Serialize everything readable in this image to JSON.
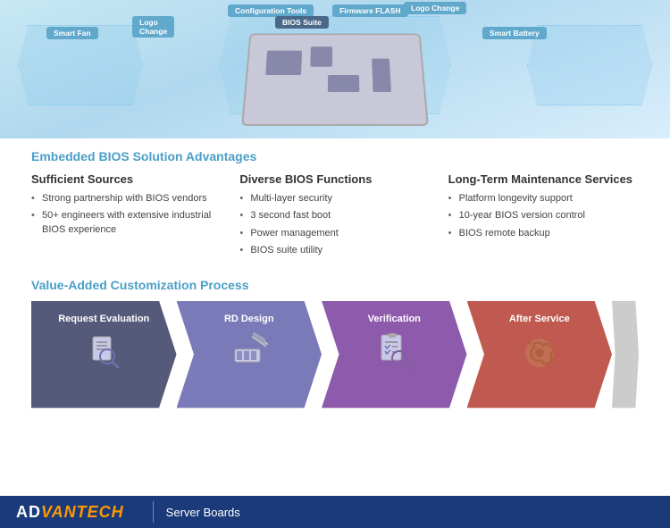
{
  "diagram": {
    "tags": {
      "smart_fan": "Smart Fan",
      "logo_change_left": "Logo\nChange",
      "config_tools": "Configuration Tools",
      "bios_suite": "BIOS Suite",
      "fw_flash": "Firmware FLASH",
      "logo_change_right": "Logo Change",
      "smart_battery": "Smart Battery"
    }
  },
  "embedded_bios": {
    "section_title": "Embedded BIOS Solution Advantages",
    "col1": {
      "header": "Sufficient Sources",
      "items": [
        "Strong partnership with BIOS vendors",
        "50+ engineers with extensive industrial BIOS experience"
      ]
    },
    "col2": {
      "header": "Diverse BIOS Functions",
      "items": [
        "Multi-layer security",
        "3 second fast boot",
        "Power management",
        "BIOS suite utility"
      ]
    },
    "col3": {
      "header": "Long-Term Maintenance Services",
      "items": [
        "Platform longevity support",
        "10-year BIOS version control",
        "BIOS remote backup"
      ]
    }
  },
  "value_added": {
    "section_title": "Value-Added Customization Process",
    "steps": [
      {
        "id": 1,
        "label": "Request Evaluation",
        "icon": "🔍"
      },
      {
        "id": 2,
        "label": "RD Design",
        "icon": "✏️"
      },
      {
        "id": 3,
        "label": "Verification",
        "icon": "📋"
      },
      {
        "id": 4,
        "label": "After Service",
        "icon": "🔧"
      }
    ]
  },
  "footer": {
    "brand_ad": "AD",
    "brand_van": "VANTECH",
    "subtitle": "Server Boards"
  }
}
